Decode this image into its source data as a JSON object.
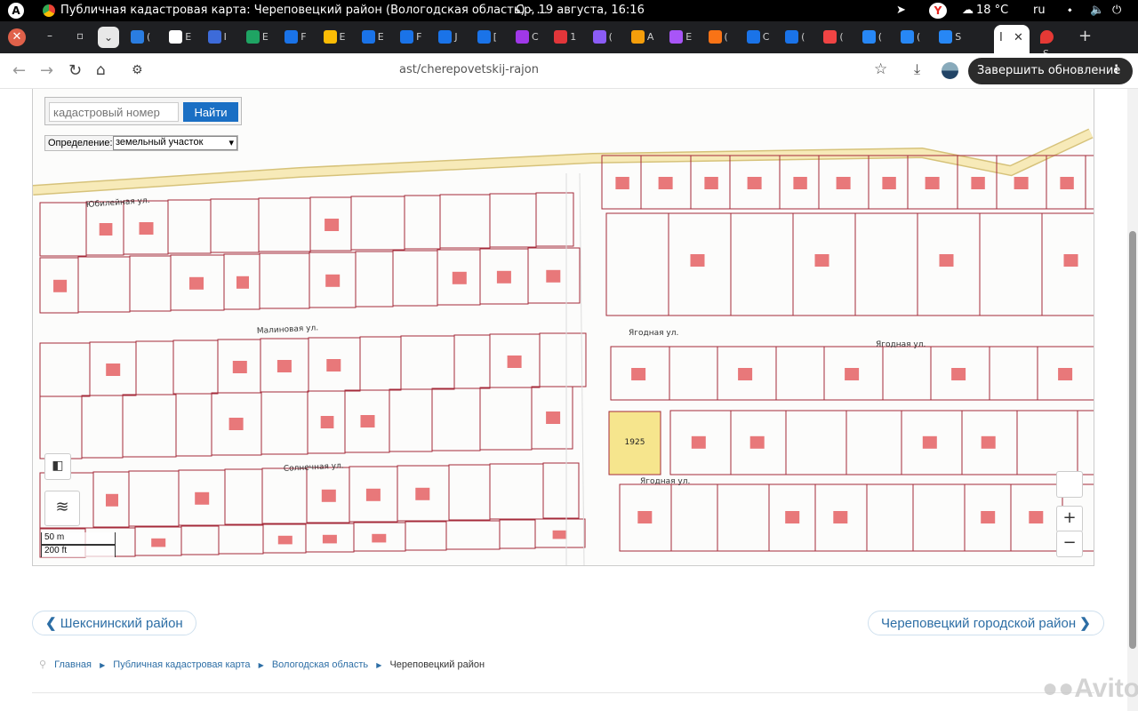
{
  "os": {
    "window_title": "Публичная кадастровая карта: Череповецкий район (Вологодская область) - ...",
    "clock": "Ср, 19 августа, 16:16",
    "weather": "18 °C",
    "lang": "ru",
    "logo_letter": "A",
    "y_letter": "Y"
  },
  "tabs": {
    "menu_glyph": "⌄",
    "mini_tabs": [
      {
        "color": "#2a7de1",
        "txt": "("
      },
      {
        "color": "#ffffff",
        "txt": "E"
      },
      {
        "color": "#3d6bd9",
        "txt": "I"
      },
      {
        "color": "#1fa463",
        "txt": "E"
      },
      {
        "color": "#1a73e8",
        "txt": "F"
      },
      {
        "color": "#fbbc05",
        "txt": "E"
      },
      {
        "color": "#1a73e8",
        "txt": "E"
      },
      {
        "color": "#1a73e8",
        "txt": "F"
      },
      {
        "color": "#1a73e8",
        "txt": "J"
      },
      {
        "color": "#1a73e8",
        "txt": "["
      },
      {
        "color": "#a038e8",
        "txt": "C"
      },
      {
        "color": "#e2363a",
        "txt": "1"
      },
      {
        "color": "#8b5cf6",
        "txt": "("
      },
      {
        "color": "#f59e0b",
        "txt": "A"
      },
      {
        "color": "#a855f7",
        "txt": "E"
      },
      {
        "color": "#f97316",
        "txt": "("
      },
      {
        "color": "#1a73e8",
        "txt": "C"
      },
      {
        "color": "#1a73e8",
        "txt": "("
      },
      {
        "color": "#ef4444",
        "txt": "("
      },
      {
        "color": "#2787f5",
        "txt": "("
      },
      {
        "color": "#2787f5",
        "txt": "("
      },
      {
        "color": "#2787f5",
        "txt": "S"
      }
    ],
    "active_tab_text": "I",
    "close_glyph": "✕",
    "last_tab_text": "S",
    "new_tab": "+"
  },
  "toolbar": {
    "url": "ast/cherepovetskij-rajon",
    "update_button": "Завершить обновление",
    "more": "⋮"
  },
  "map": {
    "search_placeholder": "кадастровый номер",
    "search_button": "Найти",
    "definition_label": "Определение:",
    "definition_value": "земельный участок",
    "zoom_in": "+",
    "zoom_out": "−",
    "scale_m": "50 m",
    "scale_ft": "200 ft",
    "streets": {
      "yubileynaya": "Юбилейная ул.",
      "malinovaya": "Малиновая ул.",
      "solnechnaya": "Солнечная ул.",
      "yagodnaya_1": "Ягодная ул.",
      "yagodnaya_2": "Ягодная ул.",
      "yagodnaya_3": "Ягодная ул."
    },
    "selected_parcel": "1925",
    "colors": {
      "parcel_border": "#a52a3a",
      "selected_fill": "#f6e58d",
      "building": "#e8787a",
      "road": "#f9f0c8"
    }
  },
  "pagination": {
    "prev": "Шекснинский район",
    "next": "Череповецкий городской район"
  },
  "breadcrumb": {
    "home": "Главная",
    "map": "Публичная кадастровая карта",
    "region": "Вологодская область",
    "current": "Череповецкий район"
  },
  "watermark": "Avito"
}
